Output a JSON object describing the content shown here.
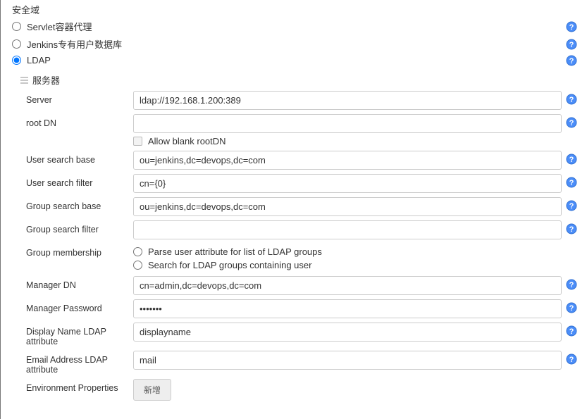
{
  "sectionTitle": "安全域",
  "realms": {
    "servlet": {
      "label": "Servlet容器代理"
    },
    "jenkins": {
      "label": "Jenkins专有用户数据库"
    },
    "ldap": {
      "label": "LDAP"
    }
  },
  "server": {
    "header": "服务器",
    "fields": {
      "server": {
        "label": "Server",
        "value": "ldap://192.168.1.200:389"
      },
      "rootDN": {
        "label": "root DN",
        "value": ""
      },
      "allowBlankRootDN": {
        "label": "Allow blank rootDN"
      },
      "userSearchBase": {
        "label": "User search base",
        "value": "ou=jenkins,dc=devops,dc=com"
      },
      "userSearchFilter": {
        "label": "User search filter",
        "value": "cn={0}"
      },
      "groupSearchBase": {
        "label": "Group search base",
        "value": "ou=jenkins,dc=devops,dc=com"
      },
      "groupSearchFilter": {
        "label": "Group search filter",
        "value": ""
      },
      "groupMembership": {
        "label": "Group membership"
      },
      "gmParse": {
        "label": "Parse user attribute for list of LDAP groups"
      },
      "gmSearch": {
        "label": "Search for LDAP groups containing user"
      },
      "managerDN": {
        "label": "Manager DN",
        "value": "cn=admin,dc=devops,dc=com"
      },
      "managerPassword": {
        "label": "Manager Password",
        "value": "secret1"
      },
      "displayNameAttr": {
        "label": "Display Name LDAP attribute",
        "value": "displayname"
      },
      "emailAttr": {
        "label": "Email Address LDAP attribute",
        "value": "mail"
      },
      "envProps": {
        "label": "Environment Properties"
      }
    },
    "addButton": "新增"
  }
}
